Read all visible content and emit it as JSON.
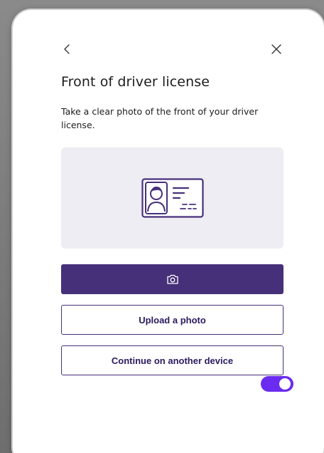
{
  "header": {
    "back_icon": "chevron-left-icon",
    "close_icon": "close-icon"
  },
  "main": {
    "title": "Front of driver license",
    "description": "Take a clear photo of the front of your driver license.",
    "preview_icon": "id-card-icon"
  },
  "actions": {
    "camera_icon": "camera-icon",
    "upload_label": "Upload a photo",
    "continue_label": "Continue on another device"
  },
  "toggle": {
    "state": "on"
  },
  "colors": {
    "primary": "#47307a",
    "toggle_accent": "#6b2bf0",
    "preview_bg": "#ededf3",
    "text": "#1c1c1c"
  }
}
